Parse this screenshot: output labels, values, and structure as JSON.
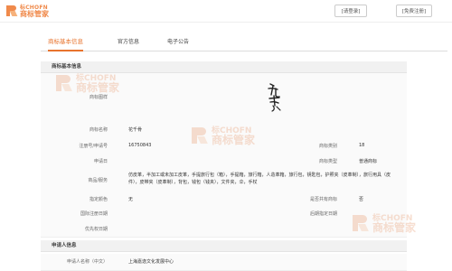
{
  "header": {
    "logo_en": "标CHOFN",
    "logo_cn": "商标管家",
    "login_label": "[请登录]",
    "register_label": "[免费注册]"
  },
  "tabs": [
    {
      "label": "商标基本信息"
    },
    {
      "label": "官方信息"
    },
    {
      "label": "电子公告"
    }
  ],
  "basic_section": {
    "title": "商标基本信息",
    "image_label": "商标图样",
    "mark_calligraphy": "花千骨",
    "name_label": "商标名称",
    "name_value": "花千骨",
    "reg_label": "注册号/申请号",
    "reg_value": "16750843",
    "class_label": "商标类别",
    "class_value": "18",
    "date_label": "申请日",
    "type_label": "商标类型",
    "type_value": "普通商标",
    "goods_label": "商品/服务",
    "goods_value": "仿皮革，半加工或未加工皮革，手提旅行包（箱），手提箱，旅行箱，人造革箱，旅行包，钥匙包，护照夹（皮革制），旅行用具（皮件），皮带夹（皮革制），背包，钱包（钱夹），文件夹，伞，手杖",
    "color_label": "指定颜色",
    "color_value": "无",
    "shared_label": "是否共有商标",
    "shared_value": "否",
    "intl_label": "国际注册日期",
    "later_label": "后期指定日期",
    "priority_label": "优先权日期"
  },
  "applicant_section": {
    "title": "申请人信息",
    "name_label": "申请人名称（中文）",
    "name_value": "上海嘉逸文化发展中心"
  },
  "watermark": {
    "en": "标CHOFN",
    "cn": "商标管家"
  },
  "colors": {
    "accent": "#e8742e",
    "watermark": "#e9a27a"
  }
}
